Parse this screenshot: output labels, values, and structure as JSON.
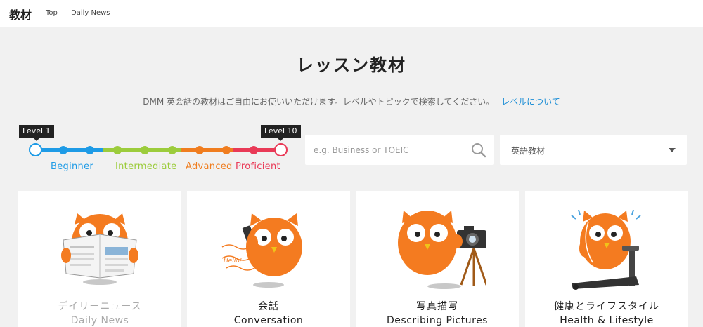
{
  "header": {
    "brand": "教材",
    "nav": [
      "Top",
      "Daily News"
    ]
  },
  "page": {
    "title": "レッスン教材",
    "subtitle": "DMM 英会話の教材はご自由にお使いいただけます。レベルやトピックで検索してください。",
    "subtitle_link": "レベルについて"
  },
  "level_slider": {
    "min_label": "Level 1",
    "max_label": "Level 10",
    "selected_range": [
      1,
      10
    ],
    "groups": [
      {
        "name": "Beginner",
        "color": "#1e9be6"
      },
      {
        "name": "Intermediate",
        "color": "#9ccc3c"
      },
      {
        "name": "Advanced",
        "color": "#f07d1f"
      },
      {
        "name": "Proficient",
        "color": "#e93a57"
      }
    ]
  },
  "search": {
    "placeholder": "e.g. Business or TOEIC",
    "icon": "search-icon"
  },
  "category_select": {
    "value": "英語教材",
    "icon": "chevron-down-icon"
  },
  "cards": [
    {
      "title_jp": "デイリーニュース",
      "title_en": "Daily News",
      "illustration": "owl-reading-newspaper"
    },
    {
      "title_jp": "会話",
      "title_en": "Conversation",
      "illustration": "owl-on-phone",
      "speech": "Hello!"
    },
    {
      "title_jp": "写真描写",
      "title_en": "Describing Pictures",
      "illustration": "owl-with-camera"
    },
    {
      "title_jp": "健康とライフスタイル",
      "title_en": "Health & Lifestyle",
      "illustration": "owl-on-treadmill"
    }
  ],
  "colors": {
    "owl_orange": "#f47b20",
    "link_blue": "#1e8fd6"
  }
}
